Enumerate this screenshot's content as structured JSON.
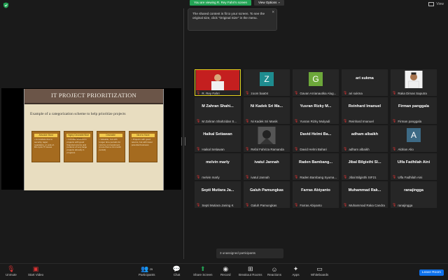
{
  "banner": {
    "viewing": "You are viewing R. Rey Fahri's screen",
    "options": "View Options"
  },
  "tooltip": {
    "text": "The shared content is fit to your screen. To see the original size, click \"Original Size\" in the menu."
  },
  "view": {
    "label": "View"
  },
  "slide": {
    "title": "IT PROJECT PRIORITIZATION",
    "subtitle": "Example of a categorization scheme to help prioritize projects",
    "boxes": [
      {
        "header": "Absolute Must",
        "body": "• A mandate due to security, legal, regulatory, or end-of-life-cycle IT issues"
      },
      {
        "header": "Highly Desirable/Nice to Have",
        "body": "• Includes short-term projects with good financial returns and portions of very large projects already in progress"
      },
      {
        "header": "Desirable",
        "body": "• Valuable, but with longer time periods for returns on investment (more than a 12-month period)"
      },
      {
        "header": "Nice to Have",
        "body": "• Projects with good returns, but with lower potential business"
      }
    ]
  },
  "participants": [
    {
      "big": "",
      "label": "R. Rey Fahri",
      "kind": "video"
    },
    {
      "big": "",
      "label": "zoom baa04",
      "kind": "letter",
      "letter": "Z",
      "color": "#1e8c8f"
    },
    {
      "big": "",
      "label": "Gavan Arrianautika Alug...",
      "kind": "letter",
      "letter": "G",
      "color": "#6da83a"
    },
    {
      "big": "ari sukma",
      "label": "ari sukma",
      "kind": "name"
    },
    {
      "big": "",
      "label": "Raka Dimas Saputra",
      "kind": "photo"
    },
    {
      "big": "M Zahran Shahi...",
      "label": "M Zahran Shahzidan S...",
      "kind": "name"
    },
    {
      "big": "Ni Kadek Sri Ma...",
      "label": "Ni Kadek Sri Manik",
      "kind": "name"
    },
    {
      "big": "Yusran Rizky M...",
      "label": "Yusran Rizky Mulyadi",
      "kind": "name"
    },
    {
      "big": "Reinhard Imanuel",
      "label": "Reinhard Imanuel",
      "kind": "name"
    },
    {
      "big": "Firman panggala",
      "label": "Firman panggala",
      "kind": "name"
    },
    {
      "big": "Haikal Setiawan",
      "label": "Haikal Setiawan",
      "kind": "name"
    },
    {
      "big": "",
      "label": "Refal Fahriza Ramanda",
      "kind": "photo2"
    },
    {
      "big": "David Helmi Ba...",
      "label": "David Helmi Bahari",
      "kind": "name"
    },
    {
      "big": "adham albaikh",
      "label": "adham albaikh",
      "kind": "name"
    },
    {
      "big": "",
      "label": "Aldrian Alio",
      "kind": "letter",
      "letter": "A",
      "color": "#3d6a85"
    },
    {
      "big": "melvin marly",
      "label": "melvin marly",
      "kind": "name"
    },
    {
      "big": "ivatul Jannah",
      "label": "ivatul Jannah",
      "kind": "name"
    },
    {
      "big": "Raden Bambang...",
      "label": "Raden Bambang Syuma...",
      "kind": "name"
    },
    {
      "big": "Jibal Bilgisthi Sl...",
      "label": "Jibal Bilgisthi SIF21",
      "kind": "name"
    },
    {
      "big": "Ulfa Fadhilah Aini",
      "label": "Ulfa Fadhilah Aini",
      "kind": "name"
    },
    {
      "big": "Septi Mutiara Ja...",
      "label": "Septi Mutiara Janing K",
      "kind": "name"
    },
    {
      "big": "Galuh Pamungkas",
      "label": "Galuh Pamungkas",
      "kind": "name"
    },
    {
      "big": "Farras Abiyanto",
      "label": "Farras Abiyanto",
      "kind": "name"
    },
    {
      "big": "Muhammad Rak...",
      "label": "Muhammad Raka Candra",
      "kind": "name"
    },
    {
      "big": "ranajingga",
      "label": "ranajingga",
      "kind": "name"
    }
  ],
  "unassigned": "3 unassigned participants",
  "toolbar": {
    "unmute": "Unmute",
    "start_video": "Start Video",
    "participants": "Participants",
    "participants_count": "25",
    "chat": "Chat",
    "share_screen": "Share Screen",
    "record": "Record",
    "breakout": "Breakout Rooms",
    "reactions": "Reactions",
    "apps": "Apps",
    "whiteboards": "Whiteboards",
    "leave": "Leave Room"
  },
  "colors": {
    "accent_green": "#23a455",
    "leave_blue": "#0e71eb",
    "active_speaker": "#e6d21c"
  }
}
